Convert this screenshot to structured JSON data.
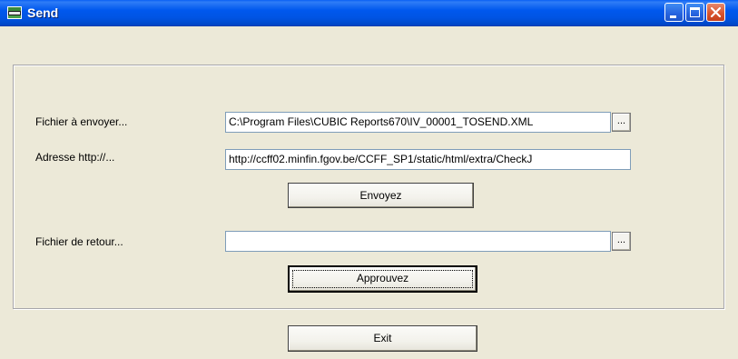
{
  "window": {
    "title": "Send"
  },
  "form": {
    "file_to_send_label": "Fichier à envoyer...",
    "file_to_send_value": "C:\\Program Files\\CUBIC Reports670\\IV_00001_TOSEND.XML",
    "address_label": "Adresse http://...",
    "address_value": "http://ccff02.minfin.fgov.be/CCFF_SP1/static/html/extra/CheckJ",
    "return_file_label": "Fichier de retour...",
    "return_file_value": "",
    "browse_label": "..."
  },
  "buttons": {
    "send_label": "Envoyez",
    "approve_label": "Approuvez",
    "exit_label": "Exit"
  },
  "icons": {
    "app": "app-icon",
    "minimize": "minimize-icon",
    "maximize": "maximize-icon",
    "close": "close-icon"
  },
  "colors": {
    "titlebar": "#0054e3",
    "dialog_bg": "#ece9d8",
    "close_button": "#d9552e"
  }
}
